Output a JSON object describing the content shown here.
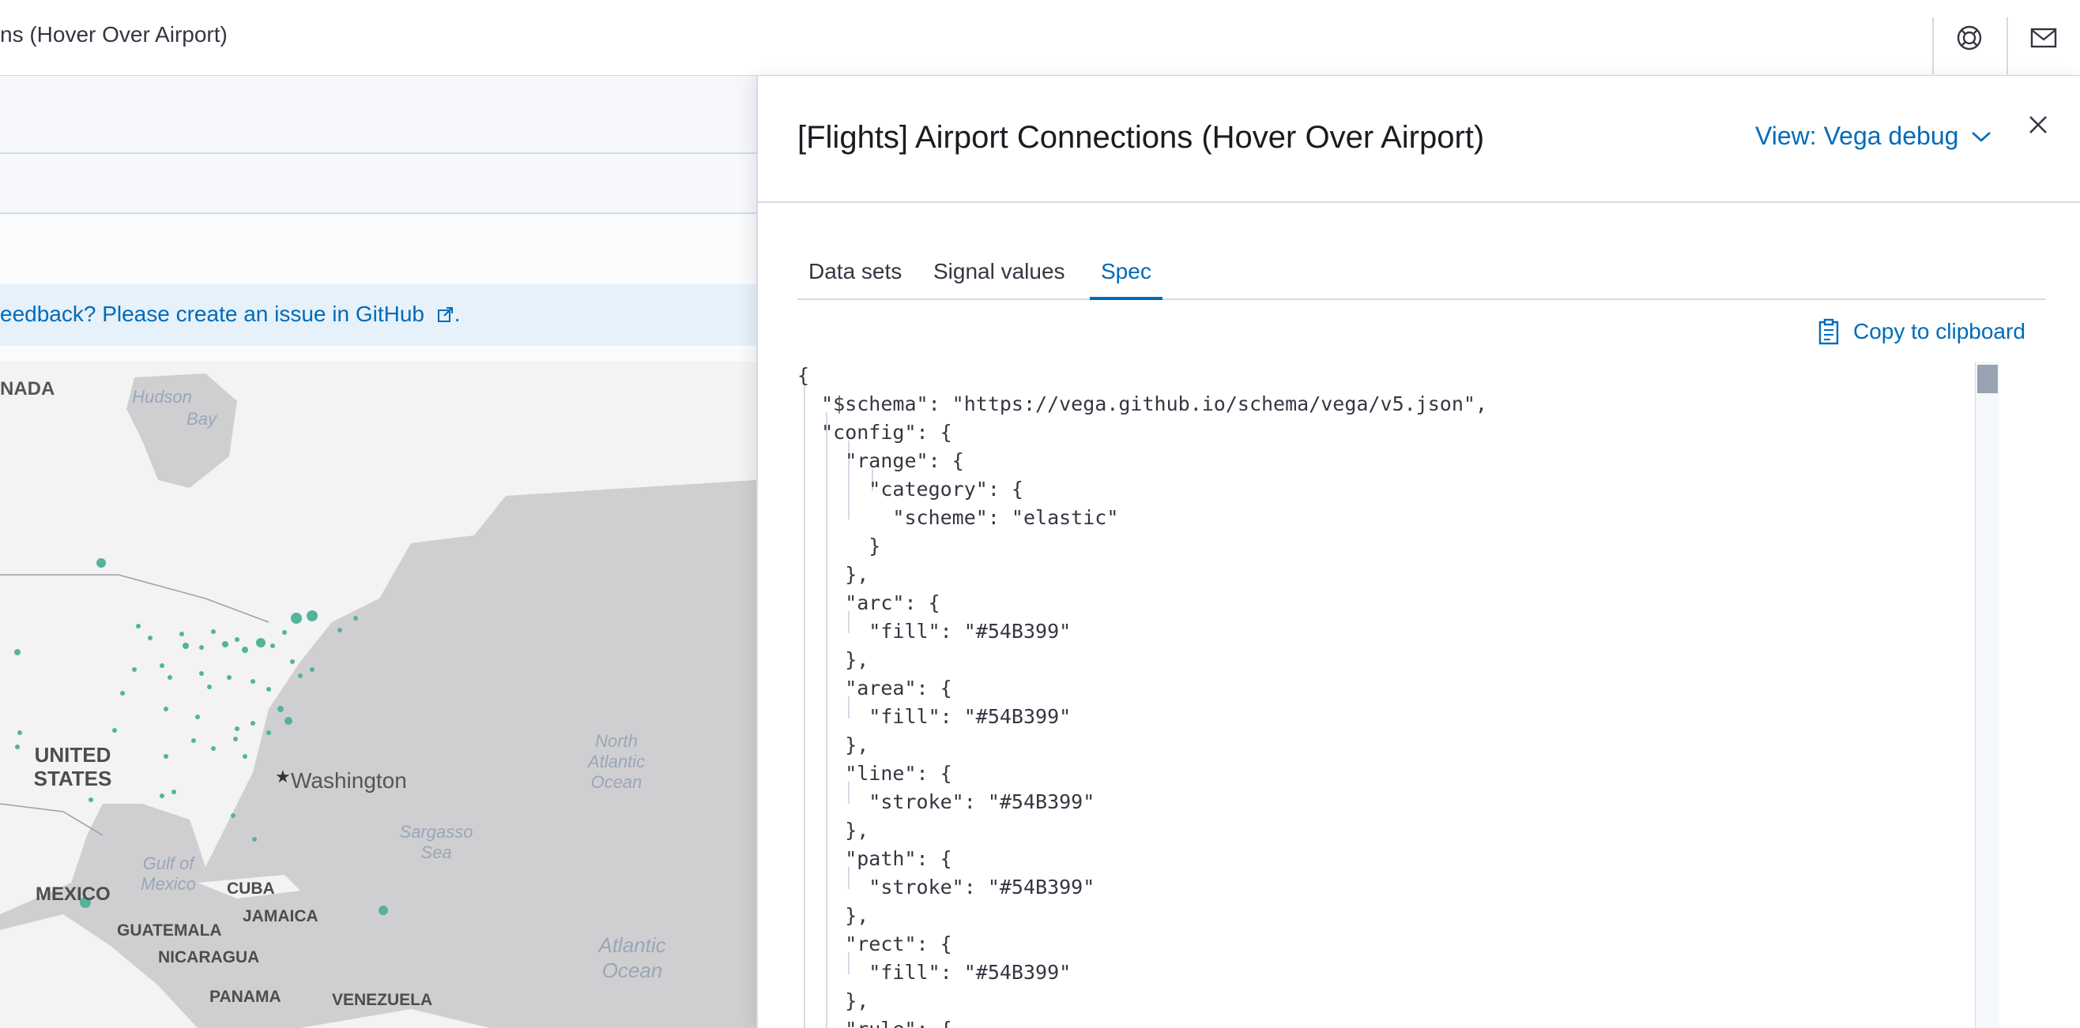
{
  "header": {
    "title_partial": "ns (Hover Over Airport)",
    "help_icon": "lifebuoy-icon",
    "mail_icon": "mail-icon"
  },
  "background": {
    "callout_text": "eedback? Please create an issue in GitHub",
    "callout_suffix": ".",
    "map_labels": {
      "canada": "NADA",
      "hudson_bay": "Hudson Bay",
      "united_states": "UNITED STATES",
      "washington": "Washington",
      "north_atlantic": "North Atlantic Ocean",
      "sargasso": "Sargasso Sea",
      "gulf": "Gulf of Mexico",
      "mexico": "MEXICO",
      "cuba": "CUBA",
      "jamaica": "JAMAICA",
      "guatemala": "GUATEMALA",
      "nicaragua": "NICARAGUA",
      "panama": "PANAMA",
      "venezuela": "VENEZUELA",
      "atlantic": "Atlantic Ocean"
    },
    "airport_color": "#54B399"
  },
  "flyout": {
    "title": "[Flights] Airport Connections (Hover Over Airport)",
    "view_selector": "View: Vega debug",
    "tabs": [
      {
        "label": "Data sets",
        "active": false
      },
      {
        "label": "Signal values",
        "active": false
      },
      {
        "label": "Spec",
        "active": true
      }
    ],
    "copy_label": "Copy to clipboard",
    "spec_lines": [
      "{",
      "  \"$schema\": \"https://vega.github.io/schema/vega/v5.json\",",
      "  \"config\": {",
      "    \"range\": {",
      "      \"category\": {",
      "        \"scheme\": \"elastic\"",
      "      }",
      "    },",
      "    \"arc\": {",
      "      \"fill\": \"#54B399\"",
      "    },",
      "    \"area\": {",
      "      \"fill\": \"#54B399\"",
      "    },",
      "    \"line\": {",
      "      \"stroke\": \"#54B399\"",
      "    },",
      "    \"path\": {",
      "      \"stroke\": \"#54B399\"",
      "    },",
      "    \"rect\": {",
      "      \"fill\": \"#54B399\"",
      "    },",
      "    \"rule\": {"
    ]
  },
  "colors": {
    "accent": "#006BB8",
    "border": "#D3DAE6",
    "text": "#1A1C21"
  }
}
